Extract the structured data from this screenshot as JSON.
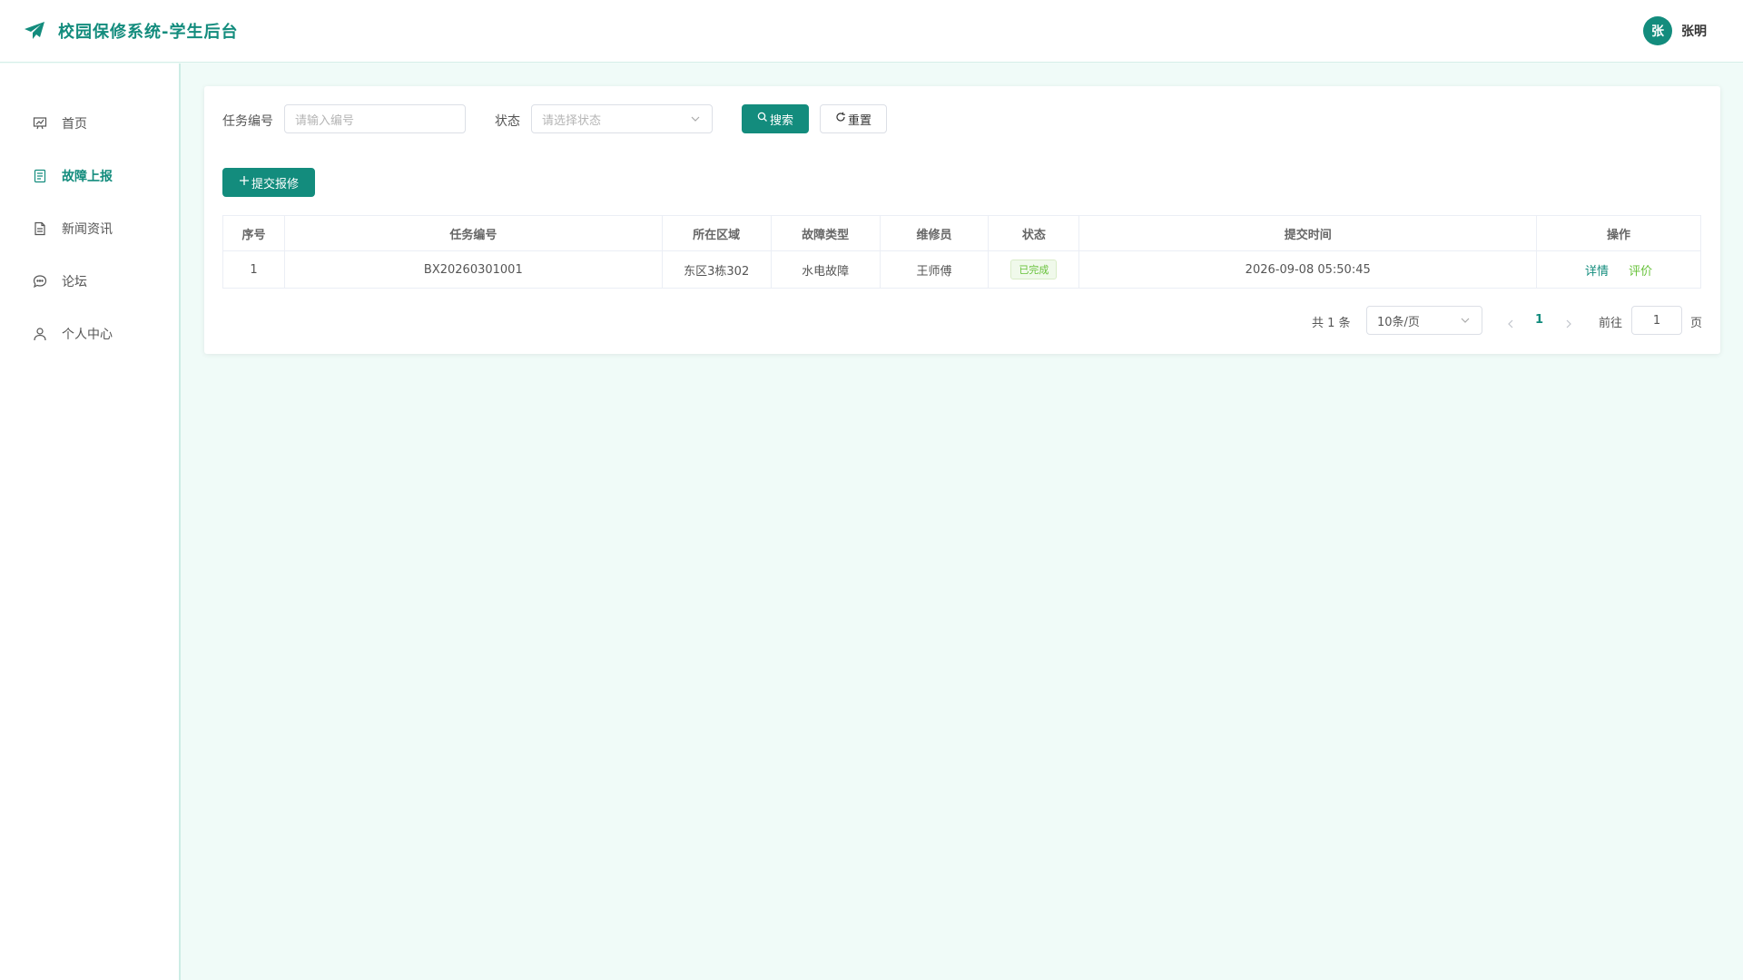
{
  "header": {
    "title": "校园保修系统-学生后台",
    "logo_icon": "paper-plane-icon",
    "user": {
      "avatar_text": "张",
      "name": "张明"
    }
  },
  "sidebar": {
    "items": [
      {
        "label": "首页",
        "icon": "presentation-chart-icon",
        "active": false
      },
      {
        "label": "故障上报",
        "icon": "document-icon",
        "active": true
      },
      {
        "label": "新闻资讯",
        "icon": "news-document-icon",
        "active": false
      },
      {
        "label": "论坛",
        "icon": "chat-bubble-icon",
        "active": false
      },
      {
        "label": "个人中心",
        "icon": "user-icon",
        "active": false
      }
    ]
  },
  "filters": {
    "task_no_label": "任务编号",
    "task_no_placeholder": "请输入编号",
    "status_label": "状态",
    "status_placeholder": "请选择状态",
    "search_label": "搜索",
    "reset_label": "重置"
  },
  "actions": {
    "submit_label": "提交报修"
  },
  "table": {
    "columns": [
      "序号",
      "任务编号",
      "所在区域",
      "故障类型",
      "维修员",
      "状态",
      "提交时间",
      "操作"
    ],
    "rows": [
      {
        "index": "1",
        "task_no": "BX20260301001",
        "area": "东区3栋302",
        "fault_type": "水电故障",
        "repairer": "王师傅",
        "status": "已完成",
        "submit_time": "2026-09-08 05:50:45",
        "op_detail": "详情",
        "op_rate": "评价"
      }
    ]
  },
  "pagination": {
    "total_text": "共 1 条",
    "page_size": "10条/页",
    "current_page": "1",
    "goto_label": "前往",
    "goto_value": "1",
    "page_suffix": "页"
  },
  "colors": {
    "primary": "#138c7d",
    "success": "#67c23a",
    "background": "#f0fbf8"
  }
}
